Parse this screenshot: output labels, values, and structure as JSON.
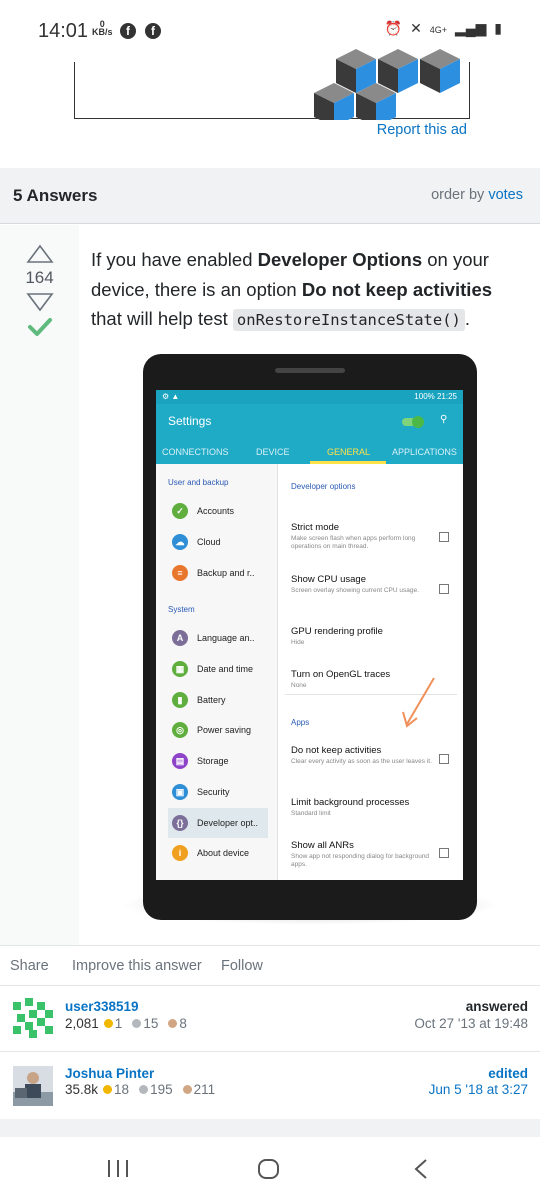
{
  "status_bar": {
    "time": "14:01",
    "net_speed_value": "0",
    "net_speed_unit": "KB/s",
    "network": "4G+"
  },
  "ad": {
    "report_link": "Report this ad"
  },
  "answers_header": {
    "count_label": "5 Answers",
    "order_by_prefix": "order by",
    "order_by_value": "votes"
  },
  "answer": {
    "vote_count": "164",
    "text_1": "If you have enabled ",
    "bold_1": "Developer Options",
    "text_2": " on your device, there is an option ",
    "bold_2": "Do not keep activities",
    "text_3": " that will help test ",
    "code": "onRestoreInstanceState()",
    "text_4": "."
  },
  "screenshot": {
    "status_right": "100% 21:25",
    "title": "Settings",
    "tabs": [
      "CONNECTIONS",
      "DEVICE",
      "GENERAL",
      "APPLICATIONS"
    ],
    "left_sections": [
      "User and backup",
      "System"
    ],
    "left_items": [
      {
        "label": "Accounts",
        "color": "#5fae3e",
        "glyph": "✓"
      },
      {
        "label": "Cloud",
        "color": "#2e8fd6",
        "glyph": "☁"
      },
      {
        "label": "Backup and r..",
        "color": "#e8762c",
        "glyph": "≡"
      },
      {
        "label": "Language an..",
        "color": "#7b6f99",
        "glyph": "A"
      },
      {
        "label": "Date and time",
        "color": "#5fae3e",
        "glyph": "▦"
      },
      {
        "label": "Battery",
        "color": "#5fae3e",
        "glyph": "▮"
      },
      {
        "label": "Power saving",
        "color": "#5fae3e",
        "glyph": "◎"
      },
      {
        "label": "Storage",
        "color": "#8e44c8",
        "glyph": "▤"
      },
      {
        "label": "Security",
        "color": "#2e8fd6",
        "glyph": "▣"
      },
      {
        "label": "Developer opt..",
        "color": "#7b6f99",
        "glyph": "{}"
      },
      {
        "label": "About device",
        "color": "#f0a020",
        "glyph": "i"
      }
    ],
    "right_sections": [
      "Developer options",
      "Apps"
    ],
    "right_items": [
      {
        "title": "Strict mode",
        "sub": "Make screen flash when apps perform long operations on main thread."
      },
      {
        "title": "Show CPU usage",
        "sub": "Screen overlay showing current CPU usage."
      },
      {
        "title": "GPU rendering profile",
        "sub": "Hide"
      },
      {
        "title": "Turn on OpenGL traces",
        "sub": "None"
      },
      {
        "title": "Do not keep activities",
        "sub": "Clear every activity as soon as the user leaves it."
      },
      {
        "title": "Limit background processes",
        "sub": "Standard limit"
      },
      {
        "title": "Show all ANRs",
        "sub": "Show app not responding dialog for background apps."
      }
    ]
  },
  "actions": {
    "share": "Share",
    "improve": "Improve this answer",
    "follow": "Follow"
  },
  "answerer": {
    "name": "user338519",
    "rep": "2,081",
    "gold": "1",
    "silver": "15",
    "bronze": "8",
    "verb": "answered",
    "when": "Oct 27 '13 at 19:48"
  },
  "editor": {
    "name": "Joshua Pinter",
    "rep": "35.8k",
    "gold": "18",
    "silver": "195",
    "bronze": "211",
    "verb": "edited",
    "when": "Jun 5 '18 at 3:27"
  },
  "colors": {
    "link": "#0a74c4",
    "accept_green": "#5eba7d",
    "gold": "#f1b600",
    "silver": "#b4b8bc",
    "bronze": "#d1a684"
  }
}
